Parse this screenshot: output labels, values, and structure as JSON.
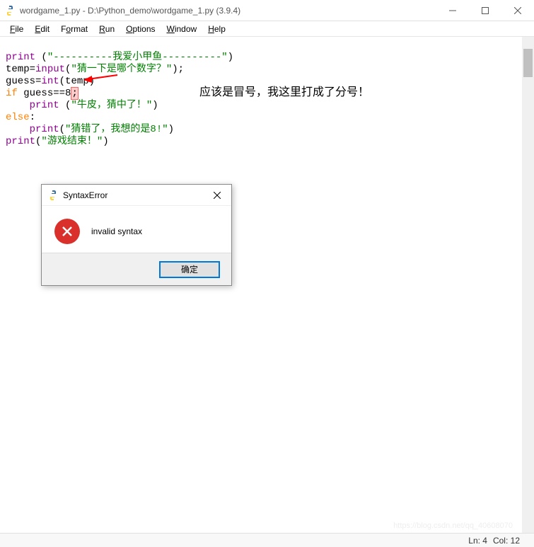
{
  "window": {
    "title": "wordgame_1.py - D:\\Python_demo\\wordgame_1.py (3.9.4)"
  },
  "menu": {
    "file": "File",
    "file_u": "F",
    "edit": "Edit",
    "edit_u": "E",
    "format": "Format",
    "format_u": "o",
    "run": "Run",
    "run_u": "R",
    "options": "Options",
    "options_u": "O",
    "window": "Window",
    "window_u": "W",
    "help": "Help",
    "help_u": "H"
  },
  "code": {
    "l1_fn": "print",
    "l1_p1": " (",
    "l1_str": "\"----------我爱小甲鱼----------\"",
    "l1_p2": ")",
    "l2_a": "temp=",
    "l2_fn": "input",
    "l2_p1": "(",
    "l2_str": "\"猜一下是哪个数字？\"",
    "l2_p2": ");",
    "l3_a": "guess=",
    "l3_fn": "int",
    "l3_p": "(temp)",
    "l4_kw": "if",
    "l4_b": " guess==8",
    "l4_err": ";",
    "l5_pad": "    ",
    "l5_fn": "print",
    "l5_p1": " (",
    "l5_str": "\"牛皮，猜中了！\"",
    "l5_p2": ")",
    "l6_kw": "else",
    "l6_p": ":",
    "l7_pad": "    ",
    "l7_fn": "print",
    "l7_p1": "(",
    "l7_str": "\"猜错了，我想的是8!\"",
    "l7_p2": ")",
    "l8_fn": "print",
    "l8_p1": "(",
    "l8_str": "\"游戏结束！\"",
    "l8_p2": ")"
  },
  "annotation": "应该是冒号，我这里打成了分号！",
  "dialog": {
    "title": "SyntaxError",
    "message": "invalid syntax",
    "ok": "确定"
  },
  "status": {
    "ln": "Ln: 4",
    "col": "Col: 12"
  },
  "watermark": "https://blog.csdn.net/qq_40608070"
}
